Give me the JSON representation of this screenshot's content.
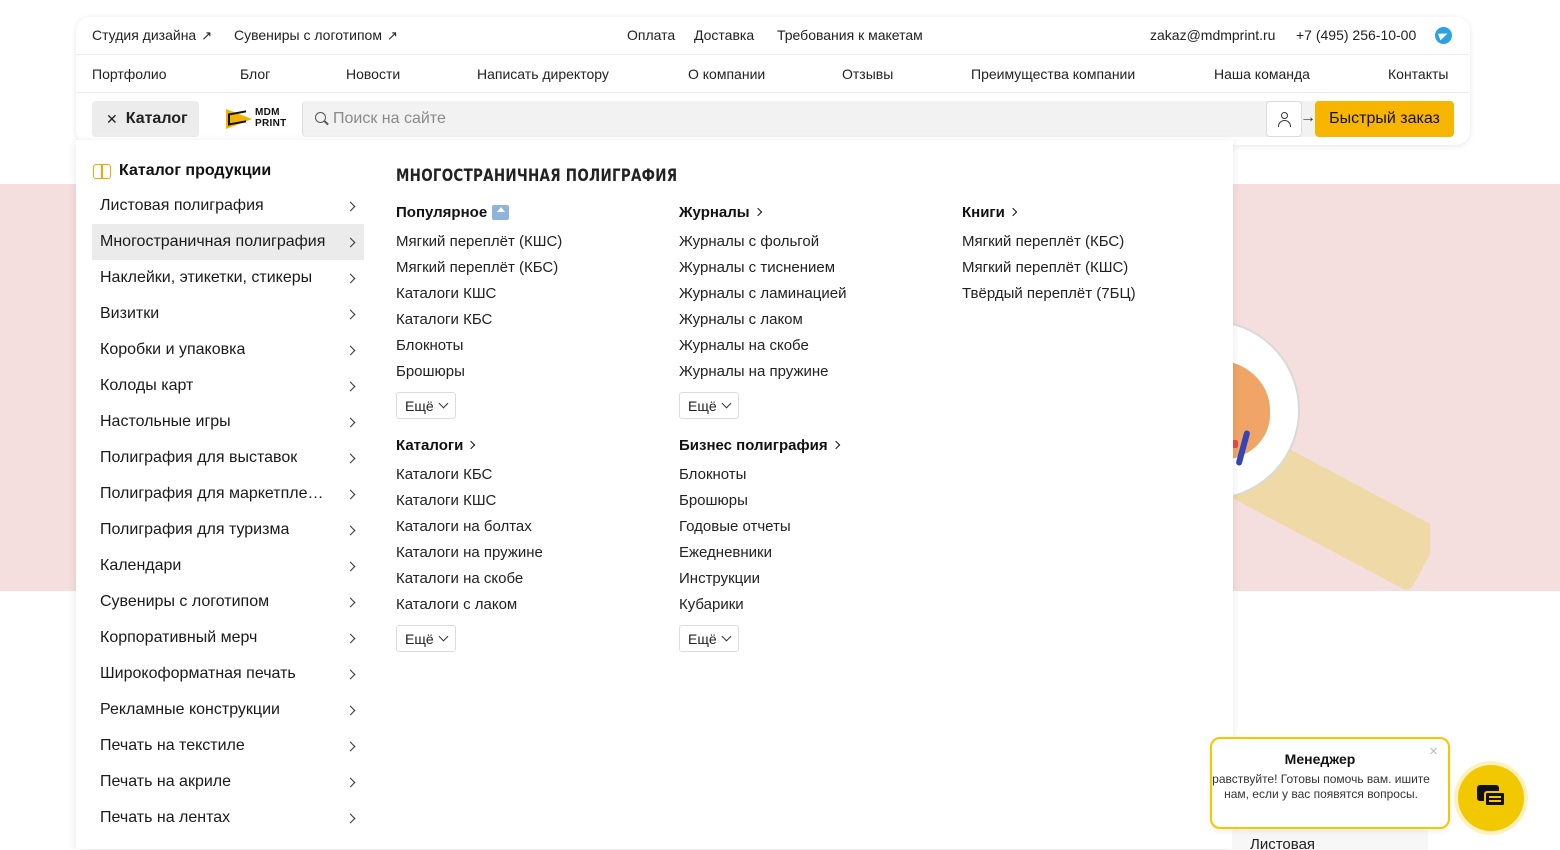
{
  "topbar": {
    "links_left": [
      {
        "label": "Студия дизайна",
        "arrow": "↗"
      },
      {
        "label": "Сувениры с логотипом",
        "arrow": "↗"
      }
    ],
    "links_center": [
      "Оплата",
      "Доставка",
      "Требования к макетам"
    ],
    "email": "zakaz@mdmprint.ru",
    "phone": "+7 (495) 256-10-00",
    "telegram_icon": "telegram-icon"
  },
  "nav": [
    "Портфолио",
    "Блог",
    "Новости",
    "Написать директору",
    "О компании",
    "Отзывы",
    "Преимущества компании",
    "Наша команда",
    "Контакты"
  ],
  "actionbar": {
    "catalog_close": "✕",
    "catalog_label": "Каталог",
    "logo_line1": "MDM",
    "logo_line2": "PRINT",
    "search_placeholder": "Поиск на сайте",
    "search_go": "→",
    "quick_order": "Быстрый заказ"
  },
  "catalog": {
    "title": "Каталог продукции",
    "items": [
      "Листовая полиграфия",
      "Многостраничная полиграфия",
      "Наклейки, этикетки, стикеры",
      "Визитки",
      "Коробки и упаковка",
      "Колоды карт",
      "Настольные игры",
      "Полиграфия для выставок",
      "Полиграфия для маркетплейсов",
      "Полиграфия для туризма",
      "Календари",
      "Сувениры с логотипом",
      "Корпоративный мерч",
      "Широкоформатная печать",
      "Рекламные конструкции",
      "Печать на текстиле",
      "Печать на акриле",
      "Печать на лентах"
    ],
    "active_index": 1
  },
  "submenu": {
    "title": "МНОГОСТРАНИЧНАЯ ПОЛИГРАФИЯ",
    "more_label": "Ещё",
    "groups": [
      {
        "head": "Популярное",
        "badge": "top-icon",
        "items": [
          "Мягкий переплёт (КШС)",
          "Мягкий переплёт (КБС)",
          "Каталоги КШС",
          "Каталоги КБС",
          "Блокноты",
          "Брошюры"
        ],
        "more": true
      },
      {
        "head": "Журналы",
        "items": [
          "Журналы с фольгой",
          "Журналы с тиснением",
          "Журналы с ламинацией",
          "Журналы с лаком",
          "Журналы на скобе",
          "Журналы на пружине"
        ],
        "more": true
      },
      {
        "head": "Книги",
        "items": [
          "Мягкий переплёт (КБС)",
          "Мягкий переплёт (КШС)",
          "Твёрдый переплёт (7БЦ)"
        ],
        "more": false
      },
      {
        "head": "Каталоги",
        "items": [
          "Каталоги КБС",
          "Каталоги КШС",
          "Каталоги на болтах",
          "Каталоги на пружине",
          "Каталоги на скобе",
          "Каталоги с лаком"
        ],
        "more": true
      },
      {
        "head": "Бизнес полиграфия",
        "items": [
          "Блокноты",
          "Брошюры",
          "Годовые отчеты",
          "Ежедневники",
          "Инструкции",
          "Кубарики"
        ],
        "more": true
      }
    ]
  },
  "chat": {
    "name": "Менеджер",
    "message": "равствуйте! Готовы помочь вам. ишите нам, если у вас появятся вопросы.",
    "close": "×",
    "bottom_card": "Листовая"
  },
  "colors": {
    "accent": "#f7b500",
    "chat_border": "#f2c800",
    "band": "#f5dede",
    "active_item": "#ebebeb"
  }
}
